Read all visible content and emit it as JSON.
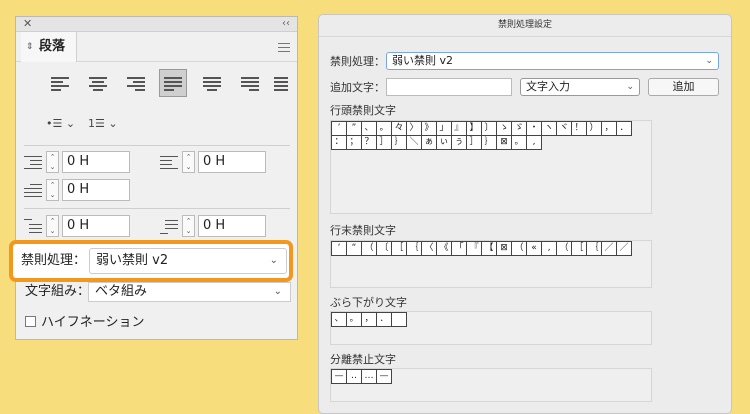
{
  "panel": {
    "close": "✕",
    "collapse": "‹‹",
    "tab_label": "段落",
    "indents": [
      "0 H",
      "0 H",
      "0 H",
      "0 H",
      "0 H"
    ],
    "kinsoku_label": "禁則処理：",
    "kinsoku_value": "弱い禁則 v2",
    "mojikumi_label": "文字組み：",
    "mojikumi_value": "ベタ組み",
    "hyphenation_label": "ハイフネーション"
  },
  "dialog": {
    "title": "禁則処理設定",
    "kinsoku_label": "禁則処理：",
    "kinsoku_value": "弱い禁則 v2",
    "add_char_label": "追加文字：",
    "input_mode": "文字入力",
    "add_button": "追加",
    "sections": [
      {
        "label": "行頭禁則文字",
        "chars": [
          "’",
          "”",
          "、",
          "。",
          "々",
          "〉",
          "》",
          "」",
          "』",
          "】",
          "〕",
          "ゝ",
          "ゞ",
          "・",
          "ヽ",
          "ヾ",
          "！",
          "）",
          "，",
          "．",
          "：",
          "；",
          "？",
          "］",
          "｝",
          "＼",
          "ぁ",
          "ぃ",
          "ぅ",
          "］",
          "｝",
          "⊠",
          "。",
          ","
        ]
      },
      {
        "label": "行末禁則文字",
        "chars": [
          "‘",
          "“",
          "（",
          "〔",
          "［",
          "｛",
          "〈",
          "《",
          "「",
          "『",
          "【",
          "⊠",
          "（",
          "«",
          "‚",
          "（",
          "［",
          "｛",
          "／",
          "／"
        ]
      },
      {
        "label": "ぶら下がり文字",
        "chars": [
          "、",
          "。",
          "，",
          "．",
          ""
        ]
      },
      {
        "label": "分離禁止文字",
        "chars": [
          "—",
          "‥",
          "…",
          "—"
        ]
      }
    ]
  }
}
